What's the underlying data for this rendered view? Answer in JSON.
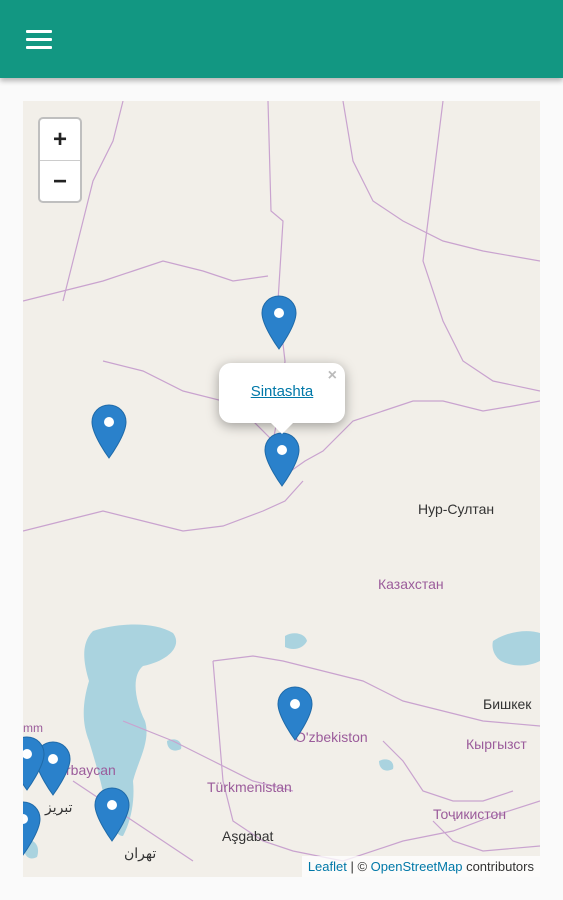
{
  "app_bar": {
    "color": "#129782",
    "menu_icon": "hamburger-menu-icon"
  },
  "map": {
    "zoom_in_label": "+",
    "zoom_out_label": "−",
    "water_color": "#aad3df",
    "land_color": "#f2efe9",
    "border_color": "#c9a3cf",
    "marker_color": "#2a81cb",
    "labels": {
      "nur_sultan": "Нур-Султан",
      "kazakhstan": "Казахстан",
      "bishkek": "Бишкек",
      "kyrgyzstan": "Кыргызст",
      "ozbekiston": "O'zbekiston",
      "turkmenistan": "Türkmenistan",
      "asgabat": "Aşgabat",
      "tajikistan": "Тоҷикистон",
      "azerbaycan": "rbaycan",
      "tabriz": "تبریز",
      "tehran": "تهران",
      "armenia_partial": "mm"
    },
    "popup": {
      "title": "Sintashta",
      "close_label": "×"
    },
    "attribution": {
      "leaflet": "Leaflet",
      "separator": " | © ",
      "osm": "OpenStreetMap",
      "suffix": " contributors"
    }
  }
}
